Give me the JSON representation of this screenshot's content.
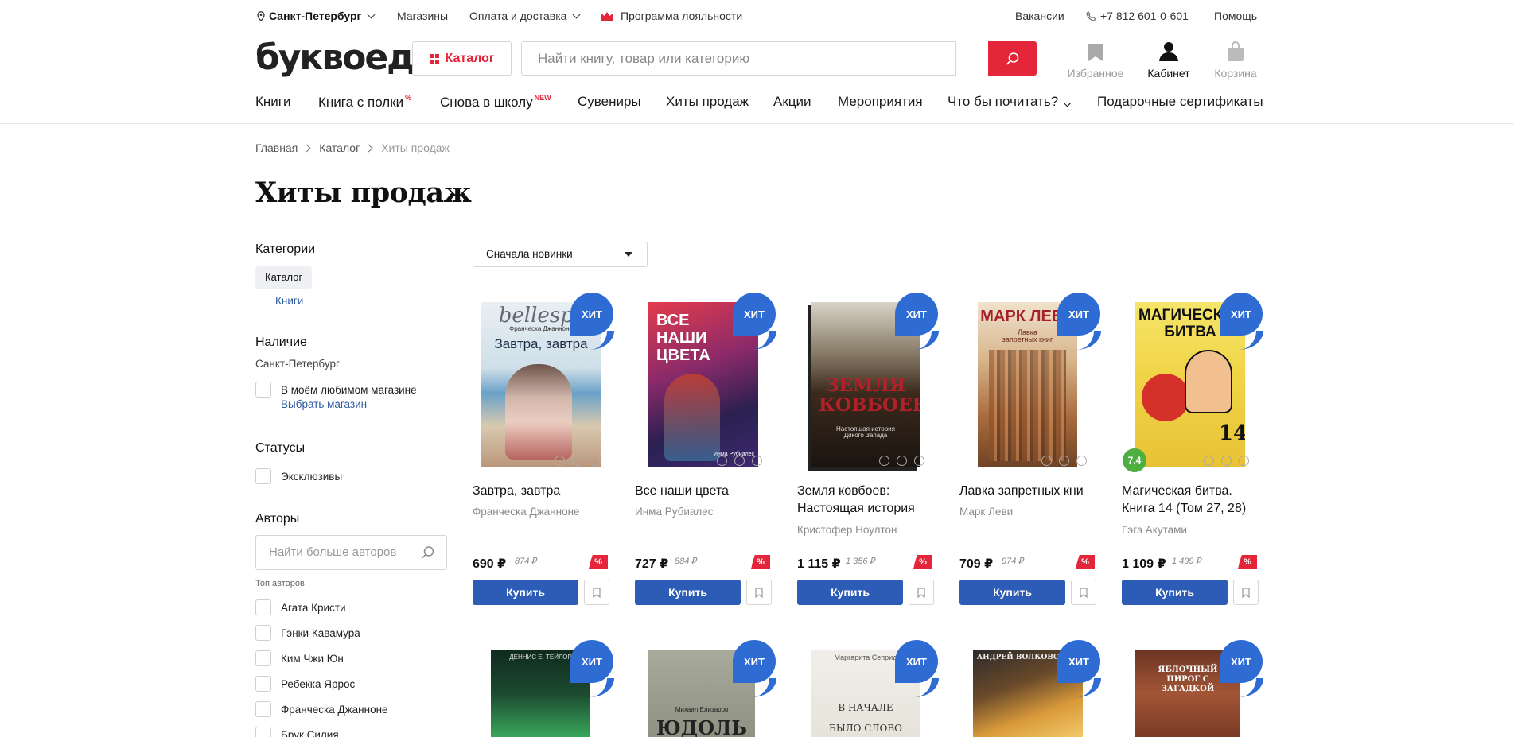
{
  "topbar": {
    "city": "Санкт-Петербург",
    "stores": "Магазины",
    "payment": "Оплата и доставка",
    "loyalty": "Программа лояльности",
    "jobs": "Вакансии",
    "phone": "+7 812 601-0-601",
    "help": "Помощь"
  },
  "header": {
    "logo": "буквоед",
    "catalog": "Каталог",
    "search_placeholder": "Найти книгу, товар или категорию",
    "favorites": "Избранное",
    "cabinet": "Кабинет",
    "cart": "Корзина"
  },
  "nav": {
    "books": "Книги",
    "shelf": "Книга с полки",
    "shelf_badge": "%",
    "school": "Снова в школу",
    "school_badge": "NEW",
    "souvenirs": "Сувениры",
    "bestsellers": "Хиты продаж",
    "promos": "Акции",
    "events": "Мероприятия",
    "what_read": "Что бы почитать?",
    "gift_cards": "Подарочные сертификаты"
  },
  "breadcrumbs": [
    "Главная",
    "Каталог",
    "Хиты продаж"
  ],
  "page_title": "Хиты продаж",
  "sidebar": {
    "categories_title": "Категории",
    "catalog_chip": "Каталог",
    "books_link": "Книги",
    "availability_title": "Наличие",
    "availability_city": "Санкт-Петербург",
    "fav_store": "В моём любимом магазине",
    "choose_store": "Выбрать магазин",
    "statuses_title": "Статусы",
    "exclusive": "Эксклюзивы",
    "authors_title": "Авторы",
    "authors_placeholder": "Найти больше авторов",
    "top_authors": "Топ авторов",
    "authors": [
      "Агата Кристи",
      "Гэнки Кавамура",
      "Ким Чжи Юн",
      "Ребекка Яррос",
      "Франческа Джанноне",
      "Брук Силия"
    ]
  },
  "sort": {
    "selected": "Сначала новинки"
  },
  "badge": {
    "hit": "ХИТ"
  },
  "buy_label": "Купить",
  "products": [
    {
      "title": "Завтра, завтра",
      "title2": "",
      "author": "Франческа Джанноне",
      "price": "690 ₽",
      "old": "874 ₽",
      "disc": "%",
      "cover_text": "Завтра, завтра",
      "cover_top": "bellespr",
      "cover_sub": "Франческа Джанноне"
    },
    {
      "title": "Все наши цвета",
      "title2": "",
      "author": "Инма Рубиалес",
      "price": "727 ₽",
      "old": "884 ₽",
      "disc": "%",
      "cover_text": "ВСЕ НАШИ ЦВЕТА",
      "cover_sub": "Инма Рубиалес"
    },
    {
      "title": "Земля ковбоев:",
      "title2": "Настоящая история",
      "author": "Кристофер Ноултон",
      "price": "1 115 ₽",
      "old": "1 356 ₽",
      "disc": "%",
      "cover_text": "ЗЕМЛЯ КОВБОЕВ",
      "cover_sub": "Настоящая история Дикого Запада"
    },
    {
      "title": "Лавка запретных кни",
      "title2": "",
      "author": "Марк Леви",
      "price": "709 ₽",
      "old": "974 ₽",
      "disc": "%",
      "cover_text": "МАРК ЛЕВИ",
      "cover_sub": "Лавка запретных книг"
    },
    {
      "title": "Магическая битва.",
      "title2": "Книга 14 (Том 27, 28)",
      "author": "Гэгэ Акутами",
      "price": "1 109 ₽",
      "old": "1 499 ₽",
      "disc": "%",
      "cover_text": "МАГИЧЕСКАЯ БИТВА",
      "cover_sub": "14",
      "rating": "7.4"
    }
  ],
  "row2": [
    {
      "cover_text": "ДЕННИС Е. ТЕЙЛОР"
    },
    {
      "cover_text": "ЮДОЛЬ",
      "cover_sub": "Михаил Елизаров"
    },
    {
      "cover_text": "В НАЧАЛЕ БЫЛО СЛОВО",
      "cover_sub": "Маргарита Сеприд"
    },
    {
      "cover_text": "АНДРЕЙ ВОЛКОВСКИЙ"
    },
    {
      "cover_text": "ЯБЛОЧНЫЙ ПИРОГ С ЗАГАДКОЙ"
    }
  ]
}
